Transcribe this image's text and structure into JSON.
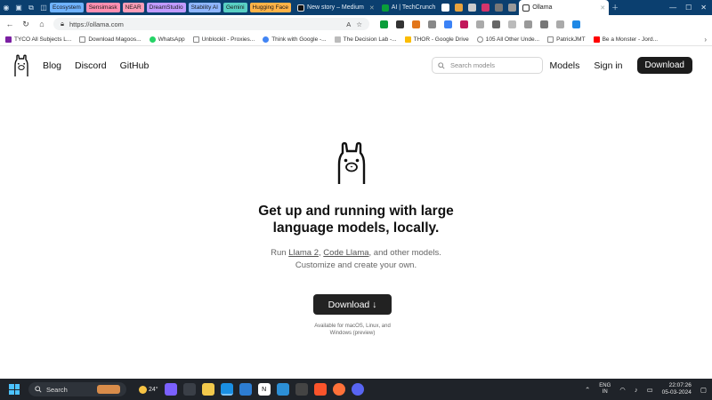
{
  "browser": {
    "tab_groups": [
      {
        "label": "Ecosystem",
        "color": "#6fb3ff"
      },
      {
        "label": "Sensimask",
        "color": "#ff8fb1"
      },
      {
        "label": "NEAR",
        "color": "#ff9db7"
      },
      {
        "label": "DreamStudio",
        "color": "#c19bff"
      },
      {
        "label": "Stability AI",
        "color": "#8fb6ff"
      },
      {
        "label": "Gemini",
        "color": "#59d0c4"
      },
      {
        "label": "Hugging Face",
        "color": "#ffb347"
      }
    ],
    "tabs": [
      {
        "label": "New story – Medium"
      },
      {
        "label": "AI | TechCrunch"
      },
      {
        "label": "Ollama"
      }
    ],
    "address": "https://ollama.com",
    "bookmarks": [
      "TYCO All Subjects L...",
      "Download Magoos...",
      "WhatsApp",
      "Unblockit - Proxies...",
      "Think with Google -...",
      "The Decision Lab -...",
      "THOR - Google Drive",
      "105 All Other Unde...",
      "PatrickJMT",
      "Be a Monster - Jord..."
    ]
  },
  "site": {
    "nav": {
      "blog": "Blog",
      "discord": "Discord",
      "github": "GitHub"
    },
    "search_placeholder": "Search models",
    "models": "Models",
    "signin": "Sign in",
    "download": "Download"
  },
  "hero": {
    "title_line1": "Get up and running with large",
    "title_line2": "language models, locally.",
    "sub_prefix": "Run ",
    "link1": "Llama 2",
    "sep": ", ",
    "link2": "Code Llama",
    "sub_suffix": ", and other models.",
    "sub_line2": "Customize and create your own.",
    "button": "Download ↓",
    "note_line1": "Available for macOS, Linux, and",
    "note_line2": "Windows (preview)"
  },
  "taskbar": {
    "search": "Search",
    "temperature": "24°",
    "lang1": "ENG",
    "lang2": "IN",
    "time": "22:07:26",
    "date": "05-03-2024"
  }
}
